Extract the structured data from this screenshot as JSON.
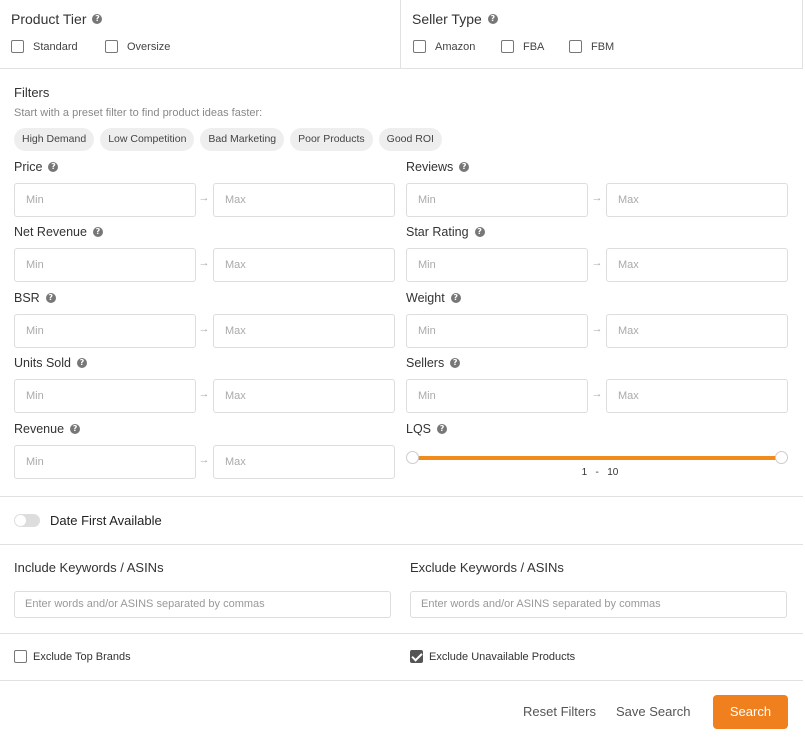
{
  "product_tier": {
    "title": "Product Tier",
    "options": [
      {
        "label": "Standard",
        "checked": false
      },
      {
        "label": "Oversize",
        "checked": false
      }
    ]
  },
  "seller_type": {
    "title": "Seller Type",
    "options": [
      {
        "label": "Amazon",
        "checked": false
      },
      {
        "label": "FBA",
        "checked": false
      },
      {
        "label": "FBM",
        "checked": false
      }
    ]
  },
  "filters": {
    "title": "Filters",
    "subtitle": "Start with a preset filter to find product ideas faster:",
    "presets": [
      "High Demand",
      "Low Competition",
      "Bad Marketing",
      "Poor Products",
      "Good ROI"
    ],
    "min_placeholder": "Min",
    "max_placeholder": "Max",
    "fields": {
      "price": "Price",
      "reviews": "Reviews",
      "net_revenue": "Net Revenue",
      "star_rating": "Star Rating",
      "bsr": "BSR",
      "weight": "Weight",
      "units_sold": "Units Sold",
      "sellers": "Sellers",
      "revenue": "Revenue",
      "lqs": "LQS"
    },
    "lqs_range": {
      "min": "1",
      "separator": "-",
      "max": "10"
    }
  },
  "date_first_available": {
    "label": "Date First Available",
    "enabled": false
  },
  "keywords": {
    "include_title": "Include Keywords / ASINs",
    "exclude_title": "Exclude Keywords / ASINs",
    "placeholder": "Enter words and/or ASINS separated by commas"
  },
  "exclusions": {
    "top_brands": {
      "label": "Exclude Top Brands",
      "checked": false
    },
    "unavailable": {
      "label": "Exclude Unavailable Products",
      "checked": true
    }
  },
  "actions": {
    "reset": "Reset Filters",
    "save": "Save Search",
    "search": "Search"
  },
  "colors": {
    "accent": "#f0801e",
    "help_icon": "#777777"
  }
}
